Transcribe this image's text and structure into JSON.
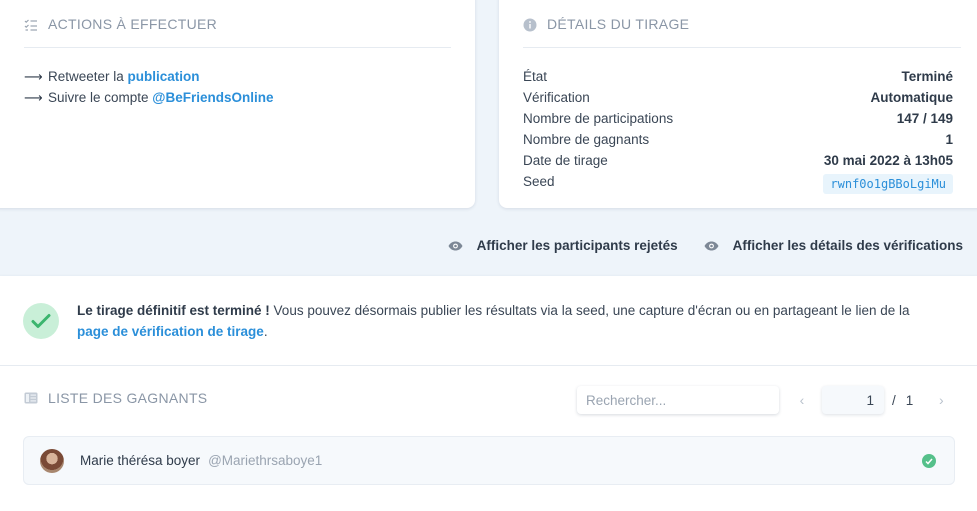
{
  "actions": {
    "title": "Actions à effectuer",
    "items": [
      {
        "prefix": "Retweeter la ",
        "link": "publication"
      },
      {
        "prefix": "Suivre le compte ",
        "link": "@BeFriendsOnline"
      }
    ]
  },
  "details": {
    "title": "Détails du tirage",
    "rows": [
      {
        "label": "État",
        "value": "Terminé"
      },
      {
        "label": "Vérification",
        "value": "Automatique"
      },
      {
        "label": "Nombre de participations",
        "value": "147 / 149"
      },
      {
        "label": "Nombre de gagnants",
        "value": "1"
      },
      {
        "label": "Date de tirage",
        "value": "30 mai 2022 à 13h05"
      },
      {
        "label": "Seed",
        "value": "rwnf0o1gBBoLgiMu"
      }
    ]
  },
  "toggles": {
    "rejected": "Afficher les participants rejetés",
    "verifications": "Afficher les détails des vérifications"
  },
  "notice": {
    "bold": "Le tirage définitif est terminé !",
    "text": " Vous pouvez désormais publier les résultats via la seed, une capture d'écran ou en partageant le lien de la ",
    "link": "page de vérification de tirage",
    "end": "."
  },
  "winners": {
    "title": "Liste des gagnants",
    "search_placeholder": "Rechercher...",
    "page_current": "1",
    "page_sep": "/",
    "page_total": "1",
    "list": [
      {
        "name": "Marie thérésa boyer",
        "handle": "@Mariethrsaboye1"
      }
    ]
  },
  "colors": {
    "accent": "#2b8fd9",
    "success": "#55c08a",
    "background": "#eef4fa"
  }
}
